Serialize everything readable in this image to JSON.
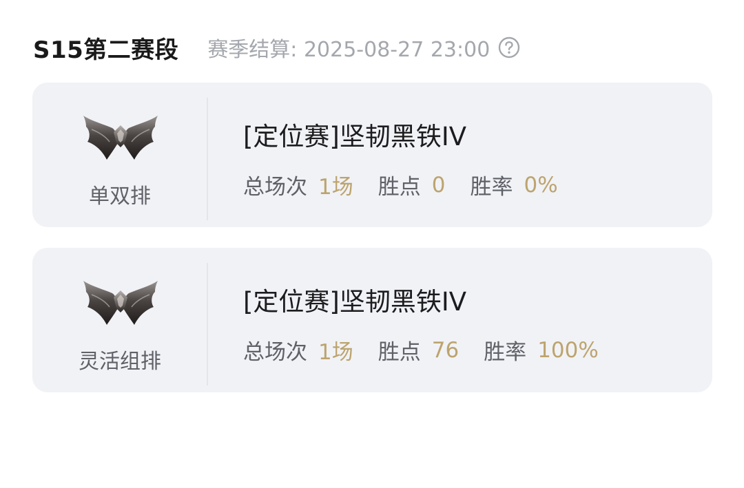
{
  "header": {
    "season_title": "S15第二赛段",
    "settlement_text": "赛季结算: 2025-08-27 23:00",
    "help_icon": "question-circle-icon"
  },
  "colors": {
    "card_background": "#f1f2f6",
    "stat_value": "#bca46e",
    "muted_text": "#a4a7ad"
  },
  "cards": [
    {
      "queue": "单双排",
      "emblem_icon": "iron-rank-emblem-icon",
      "rank": "[定位赛]坚韧黑铁IV",
      "stats": [
        {
          "label": "总场次",
          "value": "1场"
        },
        {
          "label": "胜点",
          "value": "0"
        },
        {
          "label": "胜率",
          "value": "0%"
        }
      ]
    },
    {
      "queue": "灵活组排",
      "emblem_icon": "iron-rank-emblem-icon",
      "rank": "[定位赛]坚韧黑铁IV",
      "stats": [
        {
          "label": "总场次",
          "value": "1场"
        },
        {
          "label": "胜点",
          "value": "76"
        },
        {
          "label": "胜率",
          "value": "100%"
        }
      ]
    }
  ]
}
